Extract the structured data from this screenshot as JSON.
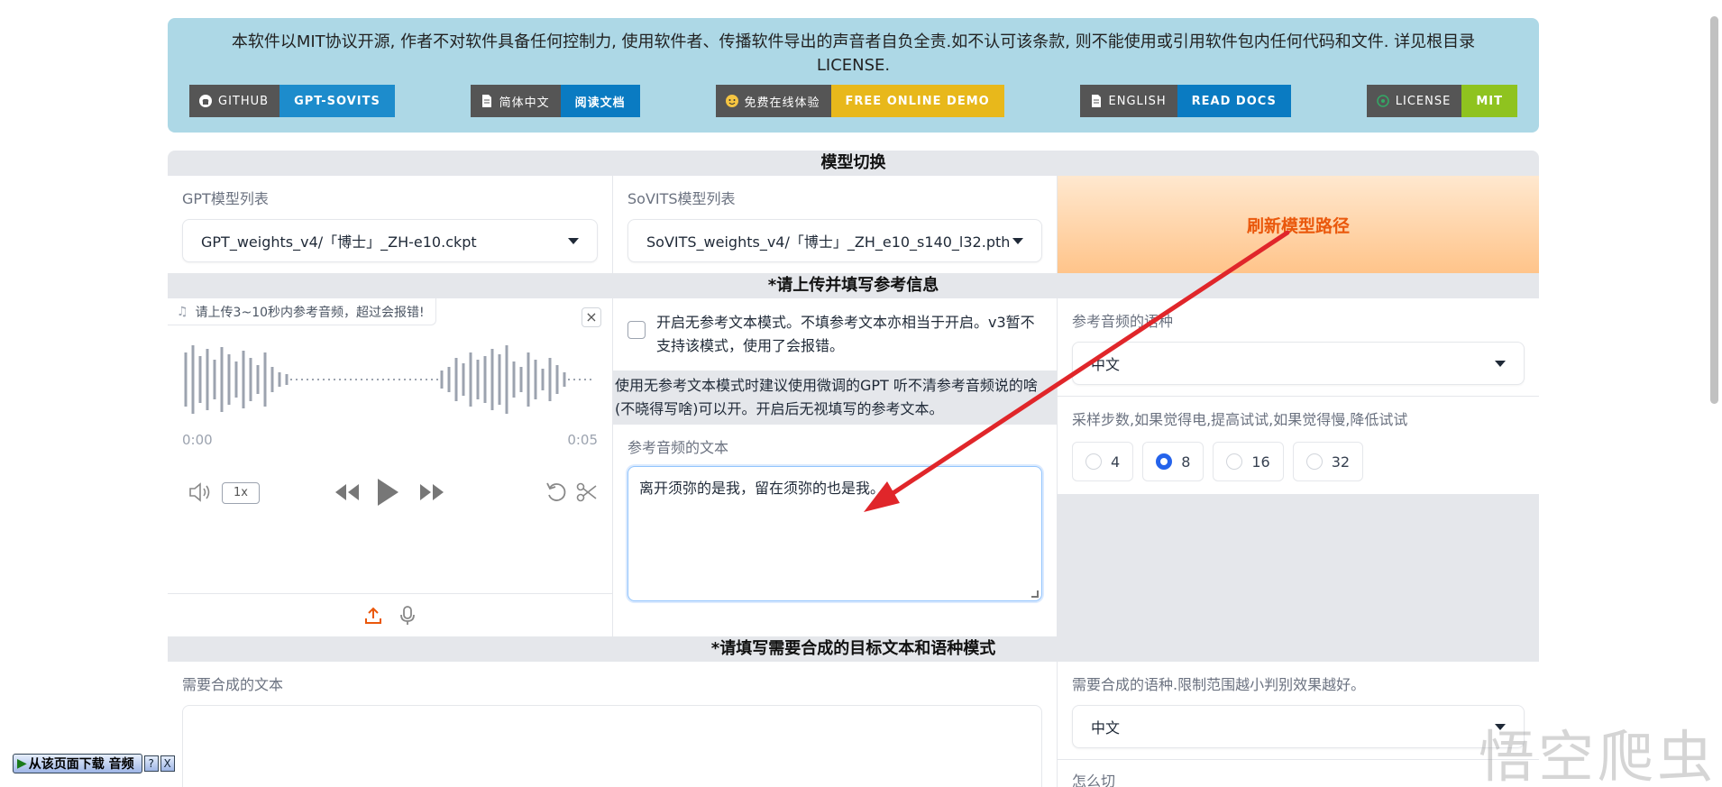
{
  "banner": {
    "text_line1": "本软件以MIT协议开源, 作者不对软件具备任何控制力, 使用软件者、传播软件导出的声音者自负全责.如不认可该条款, 则不能使用或引用软件包内任何代码和文件. 详见根目录",
    "text_line2": "LICENSE.",
    "badges": [
      {
        "left": "GITHUB",
        "right": "GPT-SOVITS",
        "icon": "github-icon",
        "color": "#1d8ccc"
      },
      {
        "left": "简体中文",
        "right": "阅读文档",
        "icon": "doc-icon",
        "color": "#0a7bc2"
      },
      {
        "left": "免费在线体验",
        "right": "FREE ONLINE DEMO",
        "icon": "huggingface-icon",
        "color": "#e8b81b"
      },
      {
        "left": "ENGLISH",
        "right": "READ DOCS",
        "icon": "doc-icon",
        "color": "#0a7bc2"
      },
      {
        "left": "LICENSE",
        "right": "MIT",
        "icon": "license-icon",
        "color": "#8fc31f"
      }
    ]
  },
  "model_section": {
    "title": "模型切换",
    "gpt_label": "GPT模型列表",
    "gpt_value": "GPT_weights_v4/「博士」_ZH-e10.ckpt",
    "sovits_label": "SoVITS模型列表",
    "sovits_value": "SoVITS_weights_v4/「博士」_ZH_e10_s140_l32.pth",
    "refresh_label": "刷新模型路径"
  },
  "ref_section": {
    "title": "*请上传并填写参考信息",
    "audio_label": "请上传3~10秒内参考音频，超过会报错!",
    "time_start": "0:00",
    "time_end": "0:05",
    "rate": "1x",
    "no_ref_checkbox": "开启无参考文本模式。不填参考文本亦相当于开启。v3暂不支持该模式，使用了会报错。",
    "no_ref_note": "使用无参考文本模式时建议使用微调的GPT 听不清参考音频说的啥(不晓得写啥)可以开。开启后无视填写的参考文本。",
    "ref_text_label": "参考音频的文本",
    "ref_text_value": "离开须弥的是我，留在须弥的也是我。",
    "ref_lang_label": "参考音频的语种",
    "ref_lang_value": "中文",
    "steps_label": "采样步数,如果觉得电,提高试试,如果觉得慢,降低试试",
    "steps_options": [
      "4",
      "8",
      "16",
      "32"
    ],
    "steps_selected": "8"
  },
  "target_section": {
    "title": "*请填写需要合成的目标文本和语种模式",
    "text_label": "需要合成的文本",
    "lang_label": "需要合成的语种.限制范围越小判别效果越好。",
    "lang_value": "中文",
    "cut_label": "怎么切"
  },
  "download_bar": {
    "label": "从该页面下载 音频",
    "help": "?",
    "close": "X"
  },
  "watermark": "悟空爬虫"
}
